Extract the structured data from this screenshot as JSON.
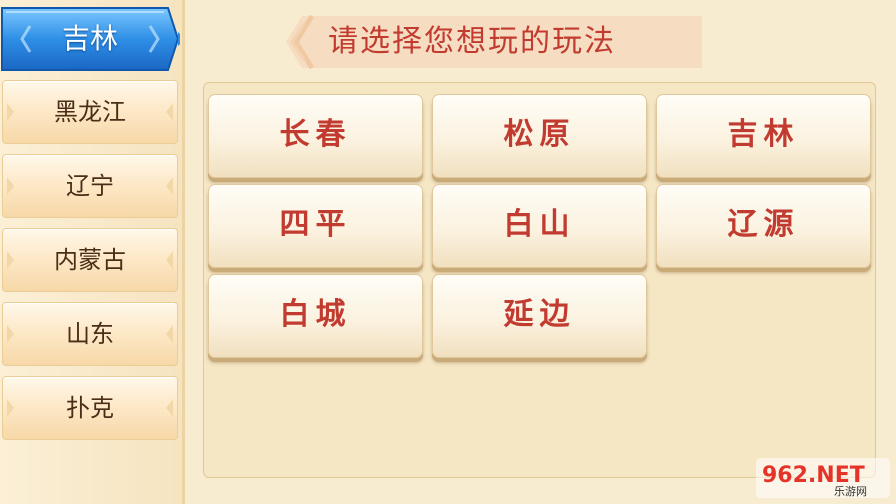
{
  "sidebar": {
    "active": {
      "label": "吉林"
    },
    "items": [
      {
        "label": "黑龙江"
      },
      {
        "label": "辽宁"
      },
      {
        "label": "内蒙古"
      },
      {
        "label": "山东"
      },
      {
        "label": "扑克"
      }
    ]
  },
  "header": {
    "title": "请选择您想玩的玩法"
  },
  "options": [
    {
      "label": "长春"
    },
    {
      "label": "松原"
    },
    {
      "label": "吉林"
    },
    {
      "label": "四平"
    },
    {
      "label": "白山"
    },
    {
      "label": "辽源"
    },
    {
      "label": "白城"
    },
    {
      "label": "延边"
    }
  ],
  "watermark": {
    "text": "962.NET",
    "subtext": "乐游网"
  },
  "colors": {
    "active_blue": "#2f8fe6",
    "title_red": "#c23b30",
    "sidebar_text": "#4a2e18"
  }
}
